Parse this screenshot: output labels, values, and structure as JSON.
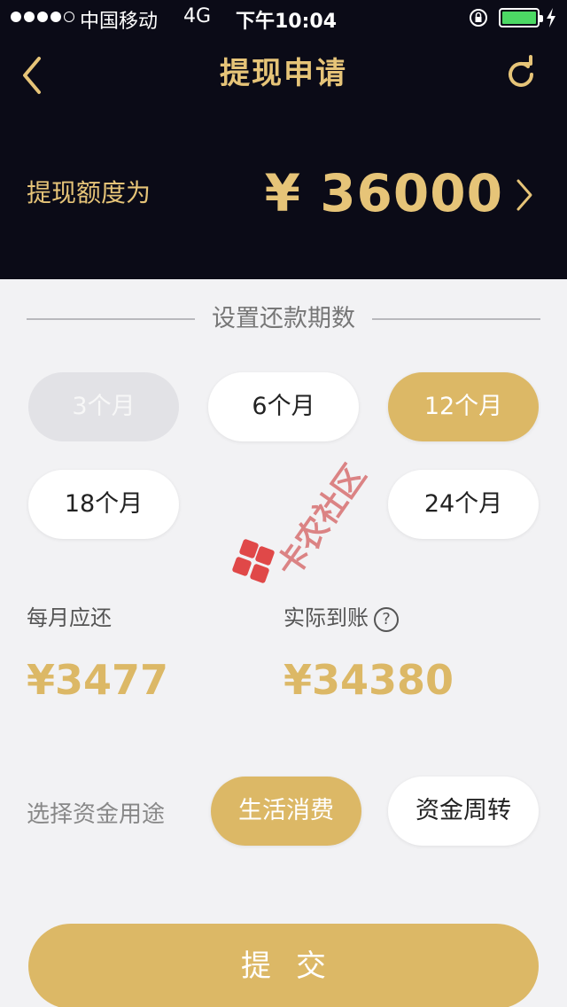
{
  "status_bar": {
    "carrier": "中国移动",
    "network": "4G",
    "time": "下午10:04"
  },
  "nav": {
    "title": "提现申请",
    "back_icon": "chevron-left-icon",
    "refresh_icon": "refresh-icon"
  },
  "quota": {
    "label": "提现额度为",
    "amount": "¥ 36000"
  },
  "repayment": {
    "section_title": "设置还款期数",
    "options": [
      {
        "label": "3个月",
        "state": "disabled"
      },
      {
        "label": "6个月",
        "state": "normal"
      },
      {
        "label": "12个月",
        "state": "selected"
      },
      {
        "label": "18个月",
        "state": "normal"
      },
      {
        "label": "24个月",
        "state": "normal"
      }
    ]
  },
  "summary": {
    "monthly_label": "每月应还",
    "monthly_amount": "¥3477",
    "received_label": "实际到账",
    "received_amount": "¥34380"
  },
  "purpose": {
    "label": "选择资金用途",
    "options": [
      {
        "label": "生活消费",
        "state": "selected"
      },
      {
        "label": "资金周转",
        "state": "normal"
      }
    ]
  },
  "submit_label": "提交",
  "watermark": "卡农社区",
  "colors": {
    "gold": "#dcb866",
    "header_bg": "#0b0b17",
    "page_bg": "#f2f2f4"
  }
}
